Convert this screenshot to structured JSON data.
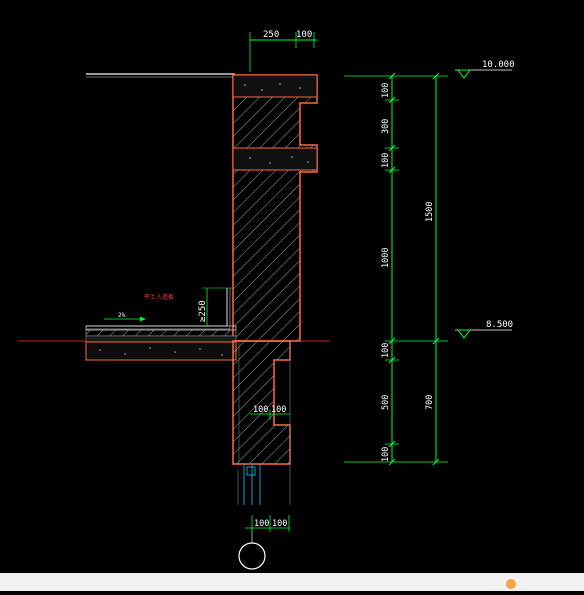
{
  "drawing": {
    "top_dims": [
      "250",
      "100"
    ],
    "bottom_dims": [
      "100",
      "100"
    ],
    "mid_dims": [
      "100",
      "100"
    ],
    "elevation_top": "10.000",
    "elevation_mid": "8.500",
    "vertical_chain_inner": [
      "100",
      "300",
      "100",
      "1000",
      "100",
      "500",
      "100"
    ],
    "vertical_chain_outer": [
      "1500",
      "700"
    ],
    "upturn_dim": "≥250",
    "slope_label": "2%",
    "annotation_red": "平土人造板"
  },
  "colors": {
    "background": "#000000",
    "concrete_outline": "#ff6b3a",
    "hatch": "#d9d9d9",
    "dimension": "#00ff33",
    "text": "#ffffff",
    "annotation": "#ff3b3b",
    "axis": "#cc2222",
    "footer": "#f2f2f2"
  }
}
